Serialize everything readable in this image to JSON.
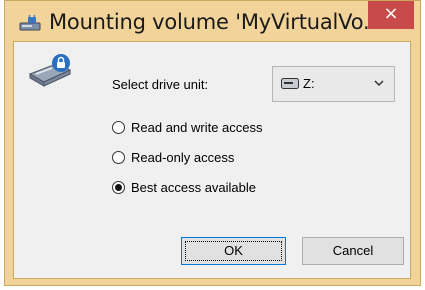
{
  "window": {
    "title": "Mounting volume 'MyVirtualVo...",
    "close_glyph": "×"
  },
  "form": {
    "drive_label": "Select drive unit:",
    "drive_value": "Z:",
    "options": [
      {
        "label": "Read and write access",
        "checked": false
      },
      {
        "label": "Read-only access",
        "checked": false
      },
      {
        "label": "Best access available",
        "checked": true
      }
    ]
  },
  "buttons": {
    "ok": "OK",
    "cancel": "Cancel"
  },
  "icons": {
    "title": "drive-lock-icon",
    "main": "encrypted-drive-icon",
    "select": "drive-icon",
    "dropdown": "chevron-down-icon"
  },
  "colors": {
    "frame": "#f2d49b",
    "close": "#c94a4a",
    "client": "#f0f0f0",
    "focus": "#0078d7"
  }
}
